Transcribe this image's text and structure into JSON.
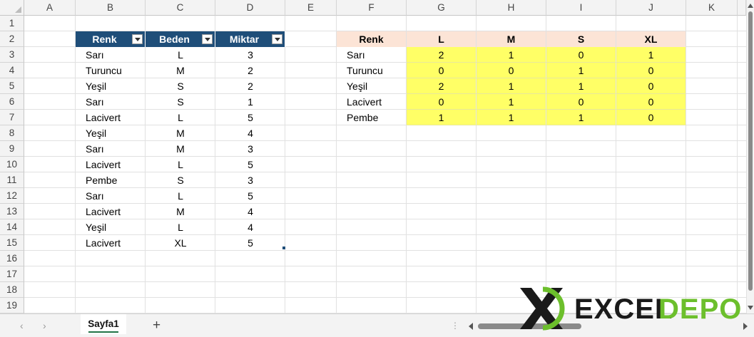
{
  "columns": [
    "A",
    "B",
    "C",
    "D",
    "E",
    "F",
    "G",
    "H",
    "I",
    "J",
    "K"
  ],
  "rows": [
    "1",
    "2",
    "3",
    "4",
    "5",
    "6",
    "7",
    "8",
    "9",
    "10",
    "11",
    "12",
    "13",
    "14",
    "15",
    "16",
    "17",
    "18",
    "19"
  ],
  "table": {
    "headers": [
      "Renk",
      "Beden",
      "Miktar"
    ],
    "rows": [
      [
        "Sarı",
        "L",
        "3"
      ],
      [
        "Turuncu",
        "M",
        "2"
      ],
      [
        "Yeşil",
        "S",
        "2"
      ],
      [
        "Sarı",
        "S",
        "1"
      ],
      [
        "Lacivert",
        "L",
        "5"
      ],
      [
        "Yeşil",
        "M",
        "4"
      ],
      [
        "Sarı",
        "M",
        "3"
      ],
      [
        "Lacivert",
        "L",
        "5"
      ],
      [
        "Pembe",
        "S",
        "3"
      ],
      [
        "Sarı",
        "L",
        "5"
      ],
      [
        "Lacivert",
        "M",
        "4"
      ],
      [
        "Yeşil",
        "L",
        "4"
      ],
      [
        "Lacivert",
        "XL",
        "5"
      ]
    ]
  },
  "pivot": {
    "headers": [
      "Renk",
      "L",
      "M",
      "S",
      "XL"
    ],
    "rows": [
      [
        "Sarı",
        "2",
        "1",
        "0",
        "1"
      ],
      [
        "Turuncu",
        "0",
        "0",
        "1",
        "0"
      ],
      [
        "Yeşil",
        "2",
        "1",
        "1",
        "0"
      ],
      [
        "Lacivert",
        "0",
        "1",
        "0",
        "0"
      ],
      [
        "Pembe",
        "1",
        "1",
        "1",
        "0"
      ]
    ]
  },
  "sheet_tabs": [
    "Sayfa1"
  ],
  "add_sheet_label": "+",
  "tab_separator": "⋮",
  "nav": {
    "prev": "‹",
    "next": "›"
  },
  "logo": {
    "mark": "X",
    "part1": "EXCEL",
    "part2": "DEPO"
  },
  "colors": {
    "table_header": "#1f4e79",
    "pivot_header": "#fce4d6",
    "pivot_values": "#ffff66",
    "logo_dark": "#1a1a1a",
    "logo_green": "#6cbf2c",
    "sheet_tab_accent": "#217346"
  }
}
